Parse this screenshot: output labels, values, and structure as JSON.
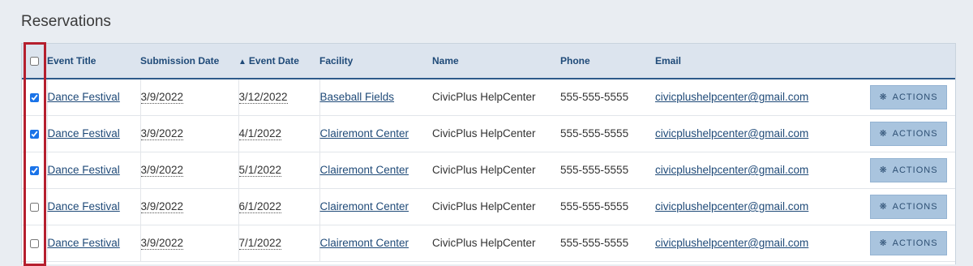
{
  "page": {
    "section_title": "Reservations"
  },
  "table": {
    "columns": [
      "Event Title",
      "Submission Date",
      "Event Date",
      "Facility",
      "Name",
      "Phone",
      "Email"
    ],
    "sort_indicator": "▲",
    "actions_label": "ACTIONS",
    "rows": [
      {
        "checked": true,
        "event_title": "Dance Festival",
        "submission_date": "3/9/2022",
        "event_date": "3/12/2022",
        "facility": "Baseball Fields",
        "name": "CivicPlus HelpCenter",
        "phone": "555-555-5555",
        "email": "civicplushelpcenter@gmail.com"
      },
      {
        "checked": true,
        "event_title": "Dance Festival",
        "submission_date": "3/9/2022",
        "event_date": "4/1/2022",
        "facility": "Clairemont Center",
        "name": "CivicPlus HelpCenter",
        "phone": "555-555-5555",
        "email": "civicplushelpcenter@gmail.com"
      },
      {
        "checked": true,
        "event_title": "Dance Festival",
        "submission_date": "3/9/2022",
        "event_date": "5/1/2022",
        "facility": "Clairemont Center",
        "name": "CivicPlus HelpCenter",
        "phone": "555-555-5555",
        "email": "civicplushelpcenter@gmail.com"
      },
      {
        "checked": false,
        "event_title": "Dance Festival",
        "submission_date": "3/9/2022",
        "event_date": "6/1/2022",
        "facility": "Clairemont Center",
        "name": "CivicPlus HelpCenter",
        "phone": "555-555-5555",
        "email": "civicplushelpcenter@gmail.com"
      },
      {
        "checked": false,
        "event_title": "Dance Festival",
        "submission_date": "3/9/2022",
        "event_date": "7/1/2022",
        "facility": "Clairemont Center",
        "name": "CivicPlus HelpCenter",
        "phone": "555-555-5555",
        "email": "civicplushelpcenter@gmail.com"
      }
    ]
  },
  "colors": {
    "highlight": "#b51f2e",
    "header_bg": "#dce4ee",
    "link": "#1f4a78",
    "button_bg": "#a9c4de"
  },
  "icons": {
    "actions": "gear-icon",
    "sort": "sort-ascending-icon"
  }
}
